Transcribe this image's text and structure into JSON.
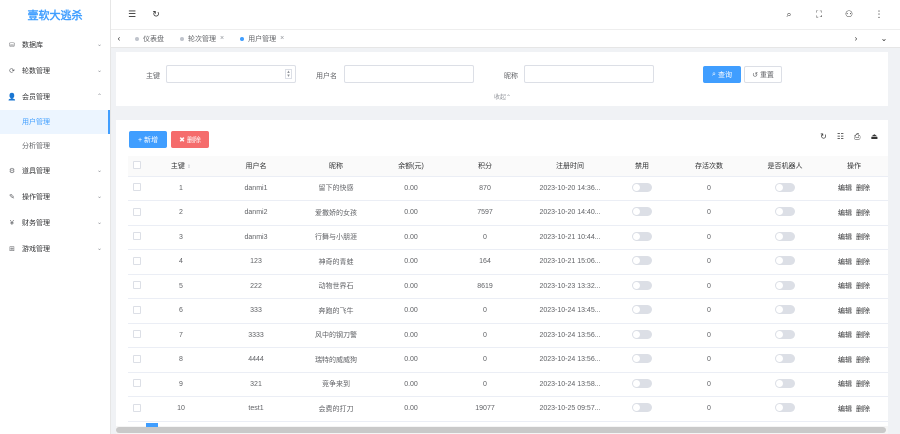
{
  "app": {
    "title": "壹软大逃杀"
  },
  "sidebar": {
    "items": [
      {
        "label": "数据库",
        "icon": "database-icon",
        "glyph": "⛁"
      },
      {
        "label": "轮数管理",
        "icon": "rounds-icon",
        "glyph": "⟳"
      },
      {
        "label": "会员管理",
        "icon": "member-icon",
        "glyph": "👤",
        "expanded": true,
        "children": [
          {
            "label": "用户管理",
            "active": true
          },
          {
            "label": "分析管理",
            "active": false
          }
        ]
      },
      {
        "label": "道具管理",
        "icon": "props-icon",
        "glyph": "⚙"
      },
      {
        "label": "操作管理",
        "icon": "operation-icon",
        "glyph": "✎"
      },
      {
        "label": "财务管理",
        "icon": "finance-icon",
        "glyph": "¥"
      },
      {
        "label": "游戏管理",
        "icon": "game-icon",
        "glyph": "⊞"
      }
    ]
  },
  "topbar": {
    "left_icons": [
      {
        "name": "menu-toggle-icon",
        "glyph": "☰"
      },
      {
        "name": "refresh-icon",
        "glyph": "↻"
      }
    ],
    "right_icons": [
      {
        "name": "search-icon",
        "glyph": "⌕"
      },
      {
        "name": "fullscreen-icon",
        "glyph": "⛶"
      },
      {
        "name": "user-icon",
        "glyph": "⚇"
      },
      {
        "name": "more-icon",
        "glyph": "⋮"
      }
    ]
  },
  "tabs": [
    {
      "label": "仪表盘",
      "active": false,
      "closable": false
    },
    {
      "label": "轮次管理",
      "active": false,
      "closable": true
    },
    {
      "label": "用户管理",
      "active": true,
      "closable": true
    }
  ],
  "search": {
    "field1_label": "主键",
    "field2_label": "用户名",
    "field3_label": "昵称",
    "query_label": "查询",
    "reset_label": "重置",
    "collapse_label": "收起"
  },
  "actions": {
    "add_label": "+ 新增",
    "delete_label": "删除"
  },
  "table": {
    "columns": [
      "主键",
      "用户名",
      "昵称",
      "余额(元)",
      "积分",
      "注册时间",
      "禁用",
      "存活次数",
      "是否机器人",
      "操作"
    ],
    "rows": [
      {
        "id": "1",
        "username": "danmi1",
        "nickname": "留下的快感",
        "balance": "0.00",
        "points": "870",
        "reg_time": "2023-10-20 14:36...",
        "survival": "0"
      },
      {
        "id": "2",
        "username": "danmi2",
        "nickname": "爱撒娇的女孩",
        "balance": "0.00",
        "points": "7597",
        "reg_time": "2023-10-20 14:40...",
        "survival": "0"
      },
      {
        "id": "3",
        "username": "danmi3",
        "nickname": "行舞与小朋涯",
        "balance": "0.00",
        "points": "0",
        "reg_time": "2023-10-21 10:44...",
        "survival": "0"
      },
      {
        "id": "4",
        "username": "123",
        "nickname": "神奇的青蛙",
        "balance": "0.00",
        "points": "164",
        "reg_time": "2023-10-21 15:06...",
        "survival": "0"
      },
      {
        "id": "5",
        "username": "222",
        "nickname": "动物世界石",
        "balance": "0.00",
        "points": "8619",
        "reg_time": "2023-10-23 13:32...",
        "survival": "0"
      },
      {
        "id": "6",
        "username": "333",
        "nickname": "奔跑的飞牛",
        "balance": "0.00",
        "points": "0",
        "reg_time": "2023-10-24 13:45...",
        "survival": "0"
      },
      {
        "id": "7",
        "username": "3333",
        "nickname": "风中的钢刀警",
        "balance": "0.00",
        "points": "0",
        "reg_time": "2023-10-24 13:56...",
        "survival": "0"
      },
      {
        "id": "8",
        "username": "4444",
        "nickname": "瑞特的威威狗",
        "balance": "0.00",
        "points": "0",
        "reg_time": "2023-10-24 13:56...",
        "survival": "0"
      },
      {
        "id": "9",
        "username": "321",
        "nickname": "竞争来到",
        "balance": "0.00",
        "points": "0",
        "reg_time": "2023-10-24 13:58...",
        "survival": "0"
      },
      {
        "id": "10",
        "username": "test1",
        "nickname": "会费的打刀",
        "balance": "0.00",
        "points": "19077",
        "reg_time": "2023-10-25 09:57...",
        "survival": "0"
      }
    ],
    "edit_label": "编辑",
    "delete_label": "删除"
  },
  "toolbar_icons": [
    {
      "name": "refresh-table-icon",
      "glyph": "↻"
    },
    {
      "name": "column-settings-icon",
      "glyph": "☷"
    },
    {
      "name": "print-icon",
      "glyph": "⎙"
    },
    {
      "name": "export-icon",
      "glyph": "⏏"
    }
  ]
}
